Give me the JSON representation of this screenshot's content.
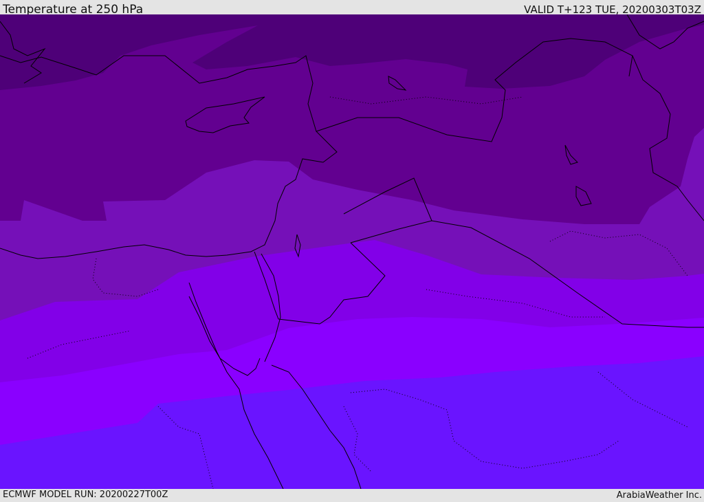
{
  "header": {
    "title": "Temperature at 250 hPa",
    "valid_time": "VALID T+123 TUE, 20200303T03Z"
  },
  "footer": {
    "model_run": "ECMWF MODEL RUN: 20200227T00Z",
    "credit": "ArabiaWeather Inc."
  },
  "map": {
    "colors": {
      "band_coldest": "#4e0078",
      "band_2": "#620090",
      "band_3": "#7510b8",
      "band_4": "#8200e8",
      "band_5": "#8a00ff",
      "band_warmest": "#6a14ff",
      "coastline": "#000000",
      "border": "#000000"
    }
  }
}
